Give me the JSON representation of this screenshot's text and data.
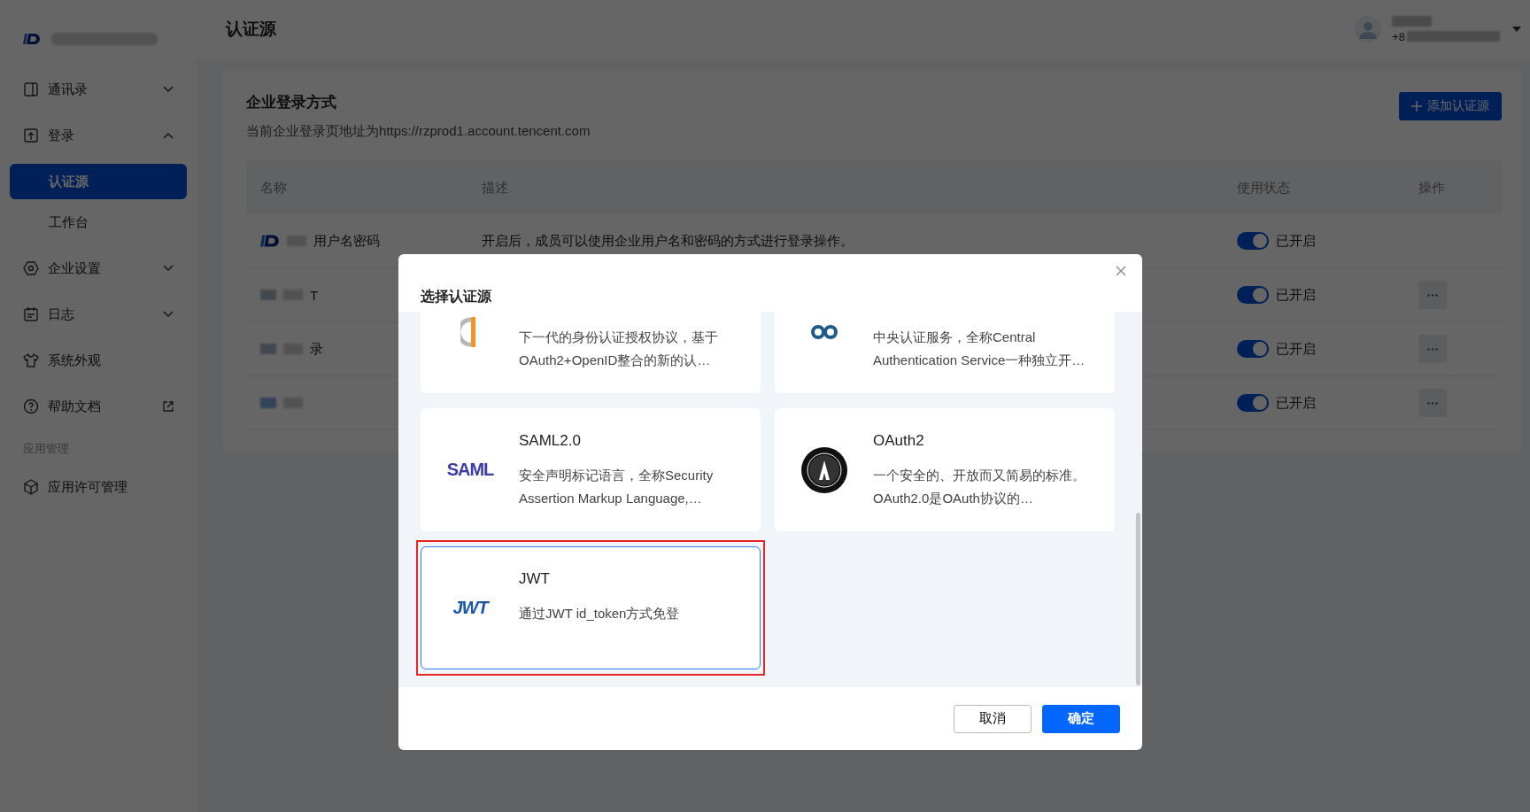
{
  "sidebar": {
    "items": [
      {
        "label": "通讯录",
        "kind": "group",
        "expanded": false
      },
      {
        "label": "登录",
        "kind": "group",
        "expanded": true,
        "children": [
          {
            "label": "认证源",
            "selected": true
          },
          {
            "label": "工作台",
            "selected": false
          }
        ]
      },
      {
        "label": "企业设置",
        "kind": "group",
        "expanded": false
      },
      {
        "label": "日志",
        "kind": "group",
        "expanded": false
      },
      {
        "label": "系统外观",
        "kind": "link"
      },
      {
        "label": "帮助文档",
        "kind": "external"
      },
      {
        "label": "应用管理",
        "kind": "section"
      },
      {
        "label": "应用许可管理",
        "kind": "link"
      }
    ]
  },
  "header": {
    "title": "认证源",
    "user_phone": "+8"
  },
  "panel": {
    "title": "企业登录方式",
    "subtitle": "当前企业登录页地址为https://rzprod1.account.tencent.com",
    "add_button": "添加认证源",
    "table": {
      "columns": [
        "名称",
        "描述",
        "使用状态",
        "操作"
      ],
      "rows": [
        {
          "name": "用户名密码",
          "description": "开启后，成员可以使用企业用户名和密码的方式进行登录操作。",
          "on": true,
          "status": "已开启"
        },
        {
          "name": "T",
          "on": true,
          "status": "已开启"
        },
        {
          "name": "录",
          "on": true,
          "status": "已开启"
        },
        {
          "on": true,
          "status": "已开启"
        }
      ]
    }
  },
  "dialog": {
    "title": "选择认证源",
    "cards": [
      {
        "kind": "openid",
        "description": "下一代的身份认证授权协议，基于OAuth2+OpenID整合的新的认…",
        "selected": false,
        "highlighted": false
      },
      {
        "kind": "cas",
        "description": "中央认证服务，全称Central Authentication Service一种独立开…",
        "selected": false,
        "highlighted": false
      },
      {
        "kind": "saml",
        "logo_text": "SAML",
        "title": "SAML2.0",
        "description": "安全声明标记语言，全称Security Assertion Markup Language,…",
        "selected": false,
        "highlighted": false
      },
      {
        "kind": "oauth",
        "title": "OAuth2",
        "description": "一个安全的、开放而又简易的标准。OAuth2.0是OAuth协议的…",
        "selected": false,
        "highlighted": false
      },
      {
        "kind": "jwt",
        "logo_text": "JWT",
        "title": "JWT",
        "description": "通过JWT id_token方式免登",
        "selected": true,
        "highlighted": true
      }
    ],
    "buttons": [
      {
        "label": "取消",
        "kind": "secondary"
      },
      {
        "label": "确定",
        "kind": "primary"
      }
    ]
  }
}
